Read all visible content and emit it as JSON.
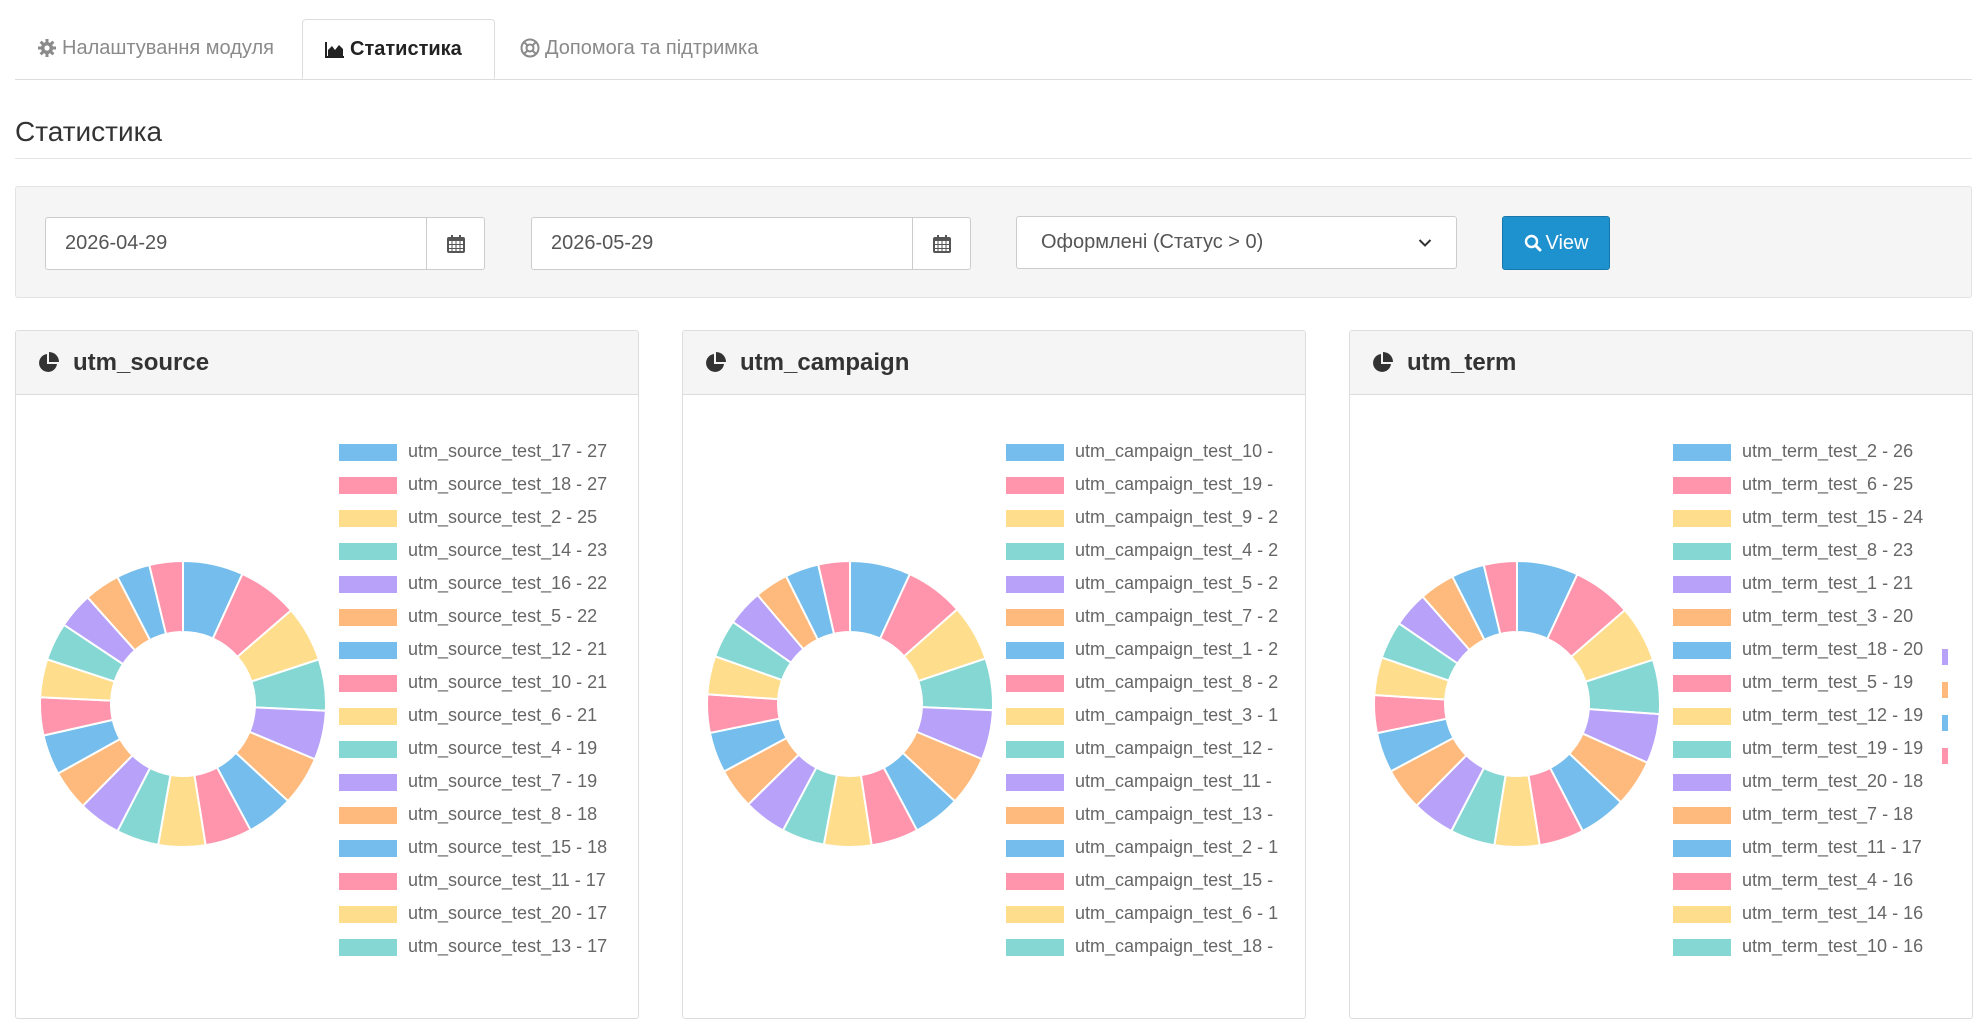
{
  "colors": [
    "#74bdec",
    "#fe95ac",
    "#fedd8d",
    "#85d7d3",
    "#b7a1f9",
    "#fdba7c"
  ],
  "tabs": [
    {
      "label": "Налаштування модуля",
      "icon": "gear-icon"
    },
    {
      "label": "Статистика",
      "icon": "area-chart-icon"
    },
    {
      "label": "Допомога та підтримка",
      "icon": "life-ring-icon"
    }
  ],
  "page": {
    "title": "Статистика"
  },
  "filter": {
    "date_from": "2026-04-29",
    "date_to": "2026-05-29",
    "status_selected": "Оформлені (Статус > 0)",
    "view_label": "View"
  },
  "panels": [
    {
      "title": "utm_source",
      "legend": [
        "utm_source_test_17 - 27",
        "utm_source_test_18 - 27",
        "utm_source_test_2 - 25",
        "utm_source_test_14 - 23",
        "utm_source_test_16 - 22",
        "utm_source_test_5 - 22",
        "utm_source_test_12 - 21",
        "utm_source_test_10 - 21",
        "utm_source_test_6 - 21",
        "utm_source_test_4 - 19",
        "utm_source_test_7 - 19",
        "utm_source_test_8 - 18",
        "utm_source_test_15 - 18",
        "utm_source_test_11 - 17",
        "utm_source_test_20 - 17",
        "utm_source_test_13 - 17"
      ],
      "chart_data": {
        "type": "pie",
        "values": [
          27,
          27,
          25,
          23,
          22,
          22,
          21,
          21,
          21,
          19,
          19,
          18,
          18,
          17,
          17,
          17,
          16,
          16,
          15,
          15
        ]
      }
    },
    {
      "title": "utm_campaign",
      "legend": [
        "utm_campaign_test_10 -",
        "utm_campaign_test_19 -",
        "utm_campaign_test_9 - 2",
        "utm_campaign_test_4 - 2",
        "utm_campaign_test_5 - 2",
        "utm_campaign_test_7 - 2",
        "utm_campaign_test_1 - 2",
        "utm_campaign_test_8 - 2",
        "utm_campaign_test_3 - 1",
        "utm_campaign_test_12 -",
        "utm_campaign_test_11 -",
        "utm_campaign_test_13 -",
        "utm_campaign_test_2 - 1",
        "utm_campaign_test_15 -",
        "utm_campaign_test_6 - 1",
        "utm_campaign_test_18 -"
      ],
      "chart_data": {
        "type": "pie",
        "values": [
          27,
          26,
          25,
          23,
          22,
          22,
          21,
          21,
          21,
          19,
          19,
          18,
          18,
          17,
          17,
          17,
          16,
          15,
          15,
          14
        ]
      }
    },
    {
      "title": "utm_term",
      "legend": [
        "utm_term_test_2 - 26",
        "utm_term_test_6 - 25",
        "utm_term_test_15 - 24",
        "utm_term_test_8 - 23",
        "utm_term_test_1 - 21",
        "utm_term_test_3 - 20",
        "utm_term_test_18 - 20",
        "utm_term_test_5 - 19",
        "utm_term_test_12 - 19",
        "utm_term_test_19 - 19",
        "utm_term_test_20 - 18",
        "utm_term_test_7 - 18",
        "utm_term_test_11 - 17",
        "utm_term_test_4 - 16",
        "utm_term_test_14 - 16",
        "utm_term_test_10 - 16"
      ],
      "chart_data": {
        "type": "pie",
        "values": [
          26,
          25,
          24,
          23,
          21,
          20,
          20,
          19,
          19,
          19,
          18,
          18,
          17,
          16,
          16,
          16,
          15,
          15,
          14,
          14
        ]
      }
    }
  ]
}
